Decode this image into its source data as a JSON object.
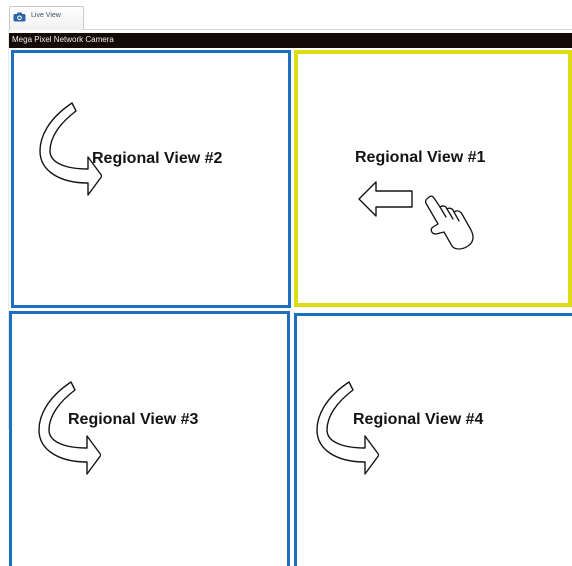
{
  "tab": {
    "label": "Live View",
    "icon": "camera-icon"
  },
  "camera": {
    "title": "Mega Pixel Network Camera"
  },
  "views": {
    "view1": {
      "label": "Regional View #1",
      "selected": true,
      "border_color": "#dedd11",
      "icons": [
        "left-arrow-icon",
        "hand-pointer-icon"
      ]
    },
    "view2": {
      "label": "Regional View #2",
      "selected": false,
      "border_color": "#1f6fbf",
      "icon": "rotate-arrow-icon"
    },
    "view3": {
      "label": "Regional View #3",
      "selected": false,
      "border_color": "#1f6fbf",
      "icon": "rotate-arrow-icon"
    },
    "view4": {
      "label": "Regional View #4",
      "selected": false,
      "border_color": "#1f6fbf",
      "icon": "rotate-arrow-icon"
    }
  },
  "colors": {
    "title_bar": "#140a06",
    "selected_border": "#dedd11",
    "view_border": "#1f6fbf"
  }
}
